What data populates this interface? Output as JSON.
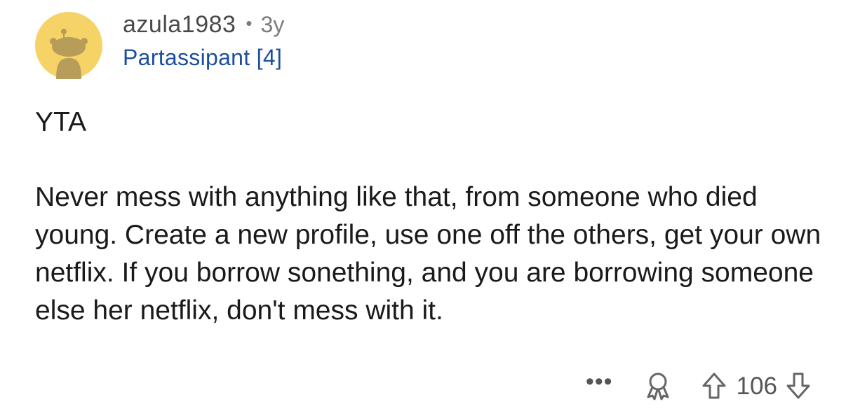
{
  "comment": {
    "username": "azula1983",
    "separator": "•",
    "age": "3y",
    "flair": "Partassipant [4]",
    "verdict": "YTA",
    "text": "Never mess with anything like that, from someone who died young.  Create a new profile, use one off the others, get your own netflix. If you borrow sonething, and you are borrowing someone else her netflix, don't mess with it.",
    "actions": {
      "more_label": "•••",
      "score": "106"
    },
    "colors": {
      "avatar_bg": "#f5d366",
      "avatar_figure": "#b89c5a",
      "flair": "#1c4e9f",
      "icon": "#666666"
    },
    "icons": {
      "avatar": "snoo-avatar-icon",
      "more": "more-options-icon",
      "award": "award-icon",
      "upvote": "upvote-arrow-icon",
      "downvote": "downvote-arrow-icon"
    }
  }
}
